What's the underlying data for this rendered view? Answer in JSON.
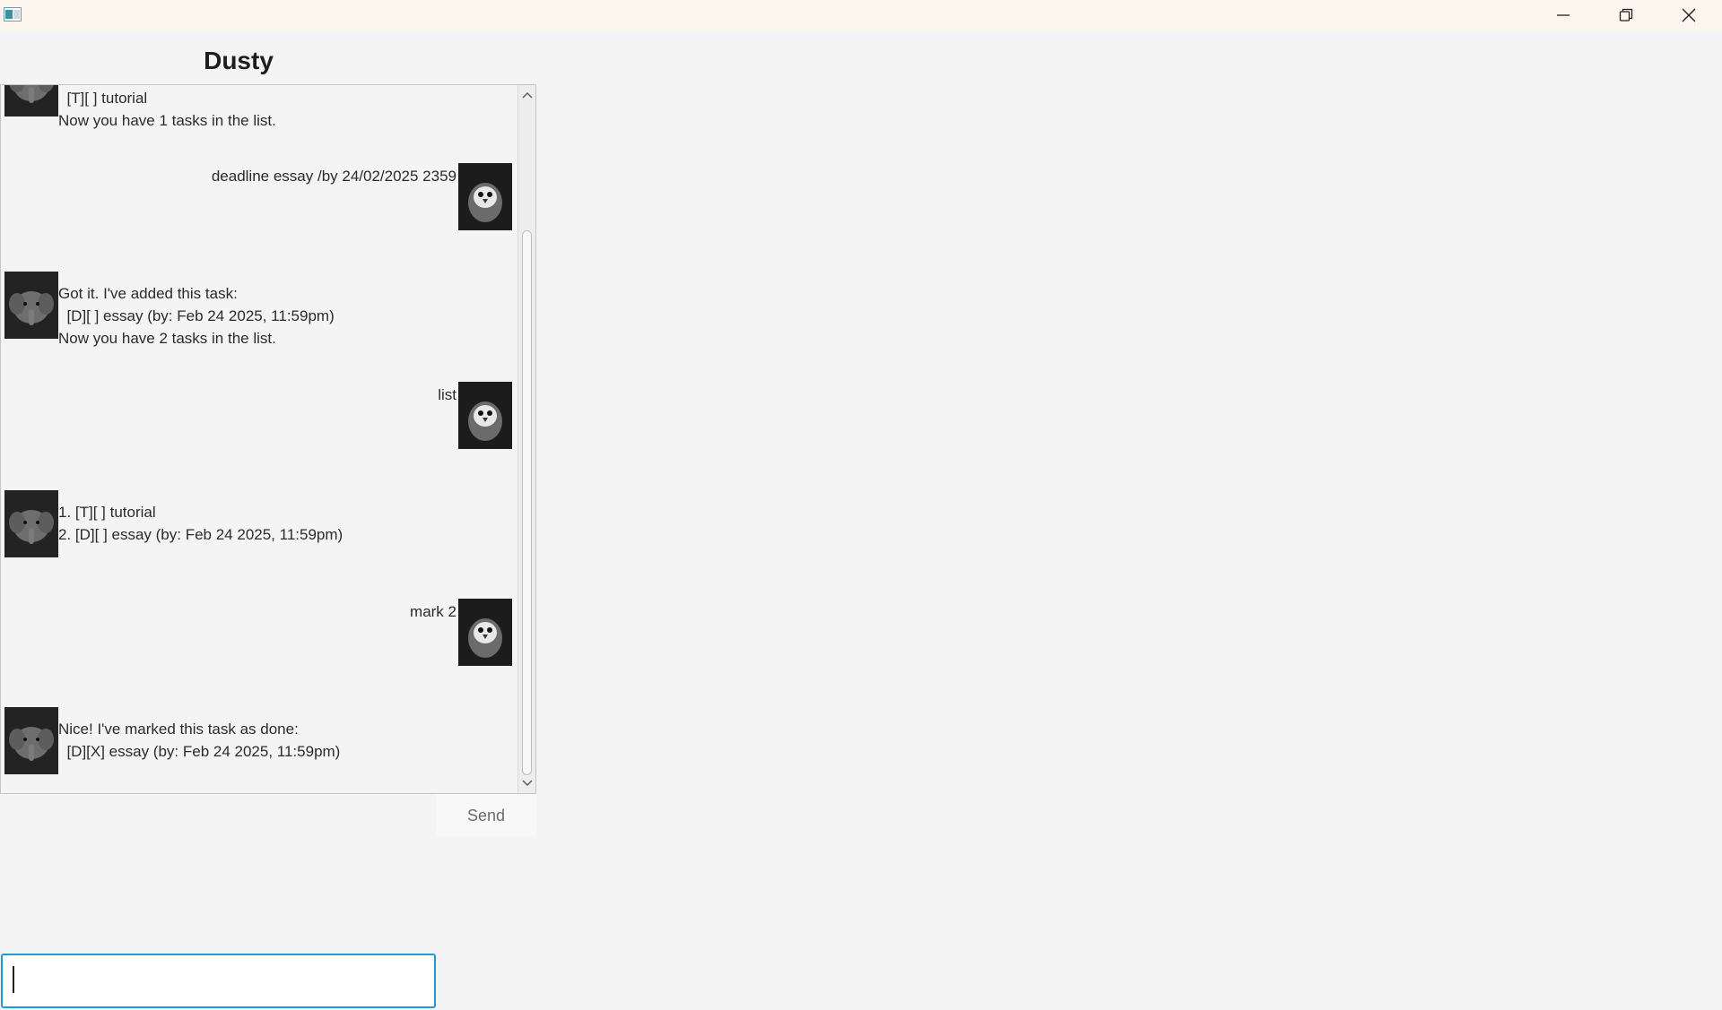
{
  "window": {
    "title": "",
    "controls": [
      "minimize-icon",
      "restore-icon",
      "close-icon"
    ]
  },
  "header": {
    "title": "Dusty"
  },
  "messages": [
    {
      "sender": "bot",
      "lines": [
        "  [T][ ] tutorial",
        "Now you have 1 tasks in the list."
      ]
    },
    {
      "sender": "user",
      "lines": [
        "deadline essay /by 24/02/2025 2359"
      ]
    },
    {
      "sender": "bot",
      "lines": [
        "Got it. I've added this task:",
        "  [D][ ] essay (by: Feb 24 2025, 11:59pm)",
        "Now you have 2 tasks in the list."
      ]
    },
    {
      "sender": "user",
      "lines": [
        "list"
      ]
    },
    {
      "sender": "bot",
      "lines": [
        "1. [T][ ] tutorial",
        "2. [D][ ] essay (by: Feb 24 2025, 11:59pm)"
      ]
    },
    {
      "sender": "user",
      "lines": [
        "mark 2"
      ]
    },
    {
      "sender": "bot",
      "lines": [
        "Nice! I've marked this task as done:",
        "  [D][X] essay (by: Feb 24 2025, 11:59pm)"
      ]
    }
  ],
  "composer": {
    "send_label": "Send",
    "input_value": ""
  },
  "colors": {
    "accent": "#1d9bd6",
    "background": "#f4f4f4",
    "titlebar": "#fbf5ee"
  }
}
